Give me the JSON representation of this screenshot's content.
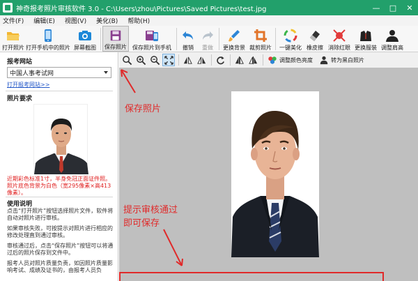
{
  "window": {
    "title": "神奇报考照片审核软件 3.0 - C:\\Users\\zhou\\Pictures\\Saved Pictures\\test.jpg",
    "controls": [
      "—",
      "□",
      "✕"
    ]
  },
  "menu": [
    "文件(F)",
    "编辑(E)",
    "视图(V)",
    "美化(B)",
    "帮助(H)"
  ],
  "toolbar": {
    "items": [
      {
        "label": "打开照片",
        "icon": "folder-open-icon"
      },
      {
        "label": "打开手机中的照片",
        "icon": "phone-icon"
      },
      {
        "label": "屏幕截图",
        "icon": "camera-icon"
      },
      {
        "label": "保存照片",
        "icon": "save-icon"
      },
      {
        "label": "保存照片到手机",
        "icon": "save-to-phone-icon"
      },
      {
        "label": "撤销",
        "icon": "undo-icon"
      },
      {
        "label": "重做",
        "icon": "redo-icon"
      },
      {
        "label": "更换背景",
        "icon": "brush-icon"
      },
      {
        "label": "裁剪照片",
        "icon": "crop-icon"
      },
      {
        "label": "一键美化",
        "icon": "color-wheel-icon"
      },
      {
        "label": "橡皮擦",
        "icon": "eraser-icon"
      },
      {
        "label": "消除红眼",
        "icon": "red-eye-icon"
      },
      {
        "label": "更换服装",
        "icon": "suit-icon"
      },
      {
        "label": "调整肩高",
        "icon": "shoulder-icon"
      }
    ]
  },
  "left_panel": {
    "site_section_title": "报考网站",
    "site_select_value": "中国人事考试网",
    "site_link": "打开报考网站>>",
    "requirement_title": "照片要求",
    "requirement_text": "近期彩色标准1寸，半身免冠正面证件照。照片底色背景为白色（宽295像素×高413像素）。",
    "usage_title": "使用说明",
    "usage_paragraphs": [
      "点击“打开照片”按钮选择照片文件，软件将自动对照片进行审核。",
      "如果审核失败，可按提示对照片进行相应的修改处理直到通过审核。",
      "审核通过后，点击“保存照片”按钮可以将通过后的照片保存到文件中。",
      "报考人员对照片质量负责，如因照片质量影响考试、成绩及证书的，由报考人员负"
    ]
  },
  "image_tools": {
    "adjust_color_label": "调整颜色亮度",
    "to_bw_label": "转为黑白照片"
  },
  "annotations": {
    "save_hint": "保存照片",
    "pass_hint_line1": "提示审核通过",
    "pass_hint_line2": "即可保存"
  },
  "colors": {
    "titlebar": "#22a06b",
    "annotation_red": "#e02a2a",
    "link_blue": "#2458c8",
    "canvas_gray": "#bfbfbf"
  }
}
